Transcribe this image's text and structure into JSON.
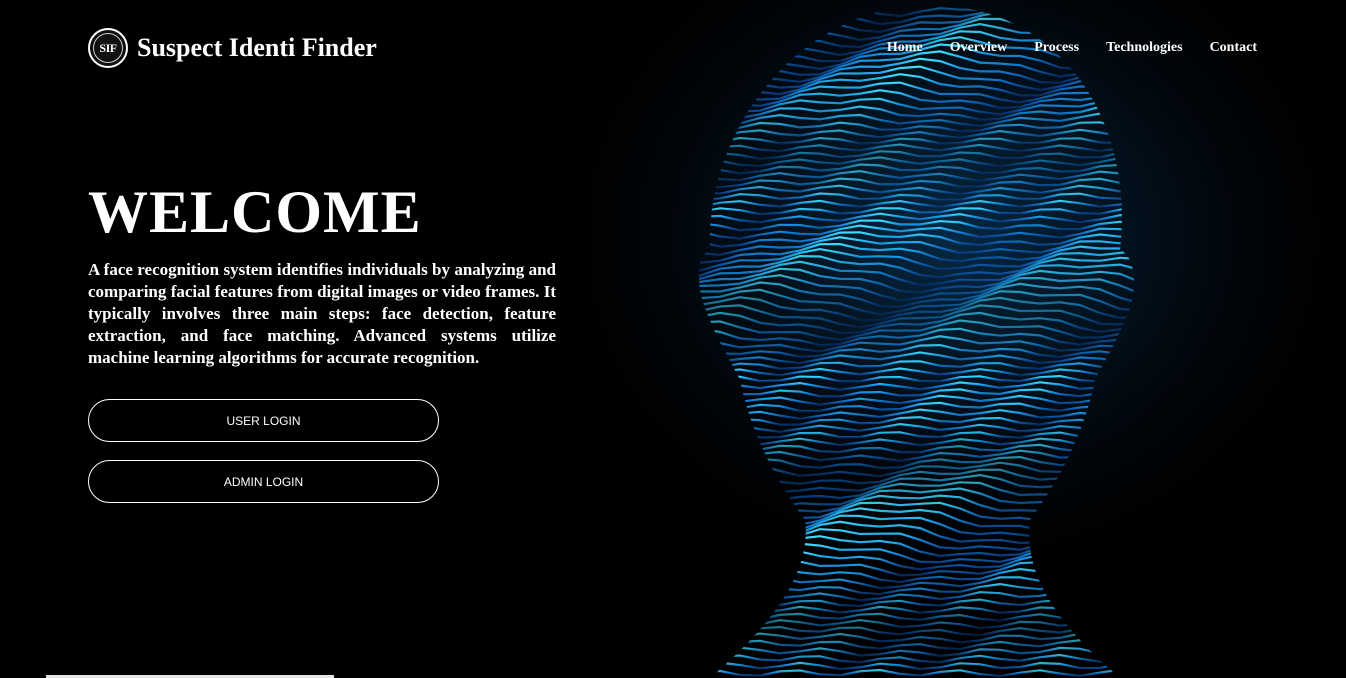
{
  "header": {
    "logo_text": "SIF",
    "title": "Suspect Identi Finder",
    "nav": [
      {
        "label": "Home"
      },
      {
        "label": "Overview"
      },
      {
        "label": "Process"
      },
      {
        "label": "Technologies"
      },
      {
        "label": "Contact"
      }
    ]
  },
  "hero": {
    "title": "WELCOME",
    "description": "A face recognition system identifies individuals by analyzing and comparing facial features from digital images or video frames. It typically involves three main steps: face detection, feature extraction, and face matching. Advanced systems utilize machine learning algorithms for accurate recognition.",
    "buttons": {
      "user_login": "USER LOGIN",
      "admin_login": "ADMIN LOGIN"
    }
  },
  "colors": {
    "background": "#000000",
    "accent_blue": "#1aa3ff",
    "text": "#ffffff"
  },
  "icons": {
    "logo": "sif-seal-icon"
  }
}
